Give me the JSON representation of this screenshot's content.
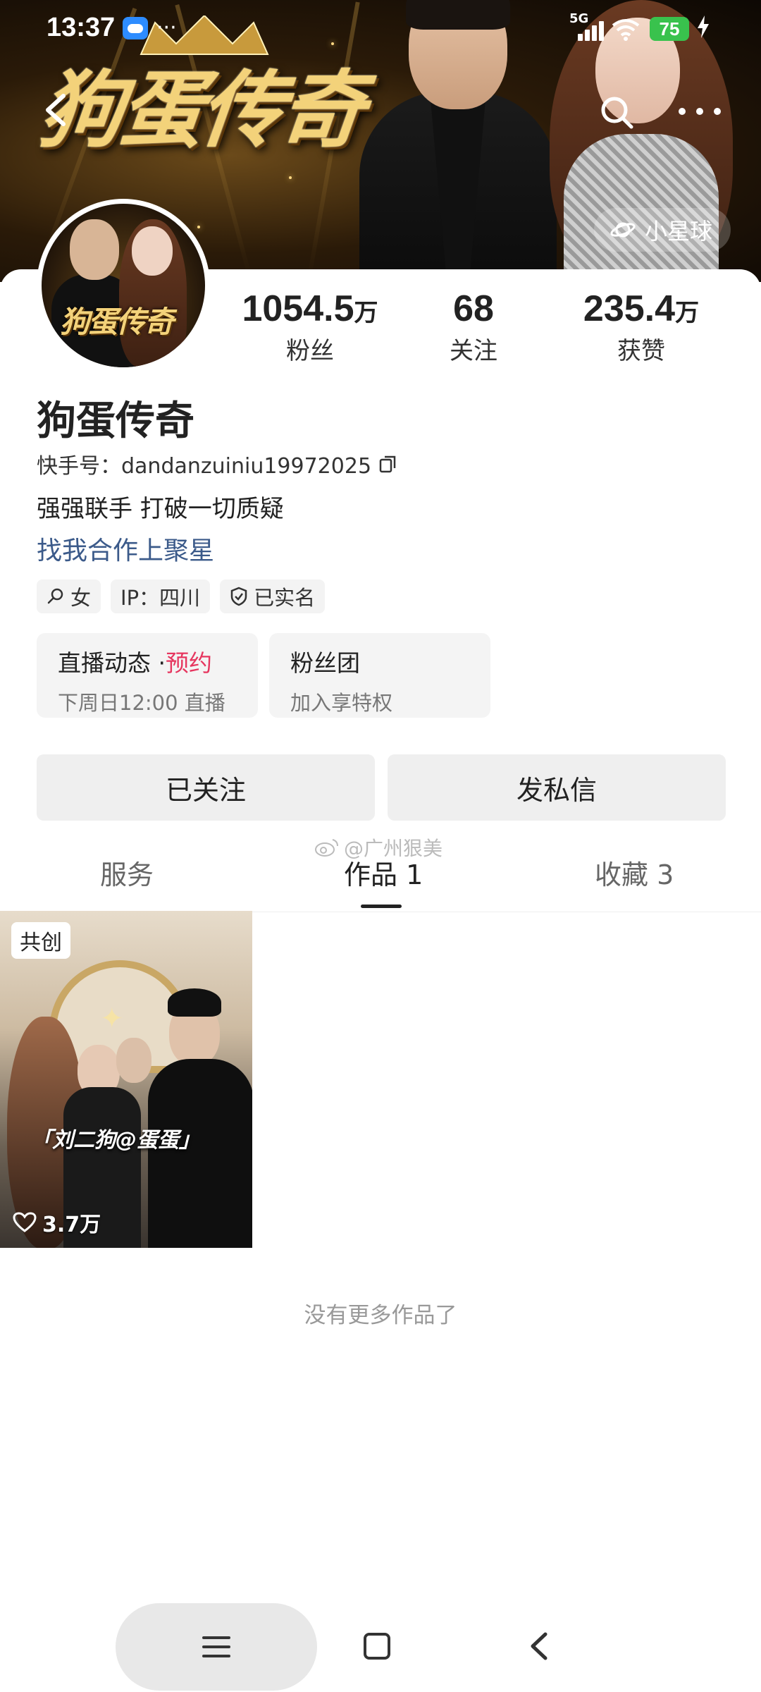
{
  "status_bar": {
    "time": "13:37",
    "more": "···",
    "network": "5G",
    "battery": "75"
  },
  "banner": {
    "title": "狗蛋传奇",
    "planet_button": "小星球"
  },
  "profile": {
    "name": "狗蛋传奇",
    "kuaishou_id": "快手号：dandanzuiniu19972025",
    "bio": "强强联手 打破一切质疑",
    "cooperation_link": "找我合作上聚星",
    "stats": [
      {
        "value": "1054.5",
        "unit": "万",
        "label": "粉丝"
      },
      {
        "value": "68",
        "unit": "",
        "label": "关注"
      },
      {
        "value": "235.4",
        "unit": "万",
        "label": "获赞"
      }
    ],
    "tags": [
      {
        "icon": "search-icon",
        "text": "女"
      },
      {
        "icon": "",
        "text": "IP：四川"
      },
      {
        "icon": "verified-shield-icon",
        "text": "已实名"
      }
    ],
    "live_card": {
      "title": "直播动态",
      "dot": "·",
      "badge": "预约",
      "subtitle": "下周日12:00 直播"
    },
    "fan_card": {
      "title": "粉丝团",
      "subtitle": "加入享特权"
    },
    "follow_button": "已关注",
    "message_button": "发私信"
  },
  "watermark": "@广州狠美",
  "tabs": [
    {
      "label": "服务"
    },
    {
      "label": "作品 1"
    },
    {
      "label": "收藏 3"
    }
  ],
  "work": {
    "badge": "共创",
    "caption": "「刘二狗@蛋蛋」",
    "likes": "3.7万"
  },
  "footer_text": "没有更多作品了",
  "colors": {
    "accent_red": "#e6365f",
    "link_blue": "#3b5a8a",
    "battery_green": "#39c24d"
  }
}
